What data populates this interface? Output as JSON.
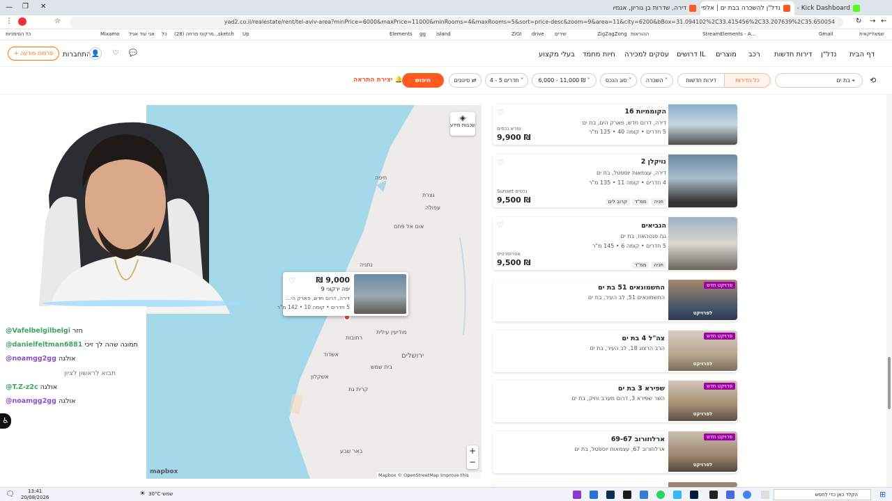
{
  "browser": {
    "tabs": [
      {
        "label": "Stream - Kick Dashboard",
        "active": false
      },
      {
        "label": "נדל\"ן להשכרה בבת ים | אלפי נכ...",
        "active": true
      },
      {
        "label": "דירה, שדרות בן גוריון, אגמים, בת...",
        "active": false
      }
    ],
    "url": "yad2.co.il/realestate/rent/tel-aviv-area?minPrice=6000&maxPrice=11000&minRooms=4&maxRooms=5&sort=price-desc&zoom=9&area=11&city=6200&bBox=31.094102%2C33.415456%2C33.207639%2C35.650054"
  },
  "bookmarks": [
    "כל הסימניות",
    "Mixamo",
    "אני עוד אגיל",
    "כל",
    "(28) מרקוס מרחה...",
    "sketch",
    "Up",
    "Elements",
    "gg",
    "island",
    "ZiGI",
    "drive",
    "שירים",
    "ZigZagZong",
    "ההוראות",
    "StreamElements - A...",
    "Gmail",
    "שמאליקאית"
  ],
  "header": {
    "nav": [
      "דף הבית",
      "נדל\"ן",
      "דירות חדשות",
      "רכב",
      "מוצרים",
      "דרושים IL",
      "עסקים למכירה",
      "חיות מחמד",
      "בעלי מקצוע"
    ],
    "login": "התחברות",
    "post_ad": "פרסום מודעה"
  },
  "search": {
    "location": "בת ים",
    "all_apartments": "כל הדירות",
    "new_apartments": "דירות חדשות",
    "deal": "השכרה",
    "property_type": "סוג הנכס",
    "price": "6,000 - 11,000 ₪",
    "rooms": "4 - 5 חדרים",
    "filters": "סינונים",
    "search_button": "חיפוש",
    "create_alert": "יצירת התראה"
  },
  "map": {
    "labels": [
      "חיפה",
      "נצרת",
      "עפולה",
      "אום אל פחם",
      "נתניה",
      "רחובות",
      "אשדוד",
      "מודיעין עילית",
      "בית שמש",
      "אשקלון",
      "קרית גת",
      "באר שבע"
    ],
    "capital": "ירושלים",
    "layers": "שכבות מידע",
    "attribution": "Mapbox © OpenStreetMap  Improve this map",
    "logo": "mapbox",
    "popup": {
      "price": "9,000 ₪",
      "street": "יפה ירקוני 9",
      "desc": "דירה, דרום חדש, פארק הי...",
      "details": "5 חדרים • קומה 10 • 142 מ\"ר"
    }
  },
  "listings": [
    {
      "title": "הקוממיות 16",
      "sub": "דירה, דרום חדש, פארק הים, בת ים",
      "details": "5 חדרים • קומה 40 • 125 מ\"ר",
      "agency": "עזרא נכסים",
      "price": "9,900 ₪",
      "tags": [],
      "new": false
    },
    {
      "title": "נויקלן 2",
      "sub": "דירה, עצמאות יוספטל, בת ים",
      "details": "4 חדרים • קומה 11 • 135 מ\"ר",
      "agency": "Sunset נכסים",
      "price": "9,500 ₪",
      "tags": [
        "חניה",
        "ממ\"ד",
        "קרוב לים"
      ],
      "new": false
    },
    {
      "title": "הנביאים",
      "sub": "גג/ פנטהאוז, בת ים",
      "details": "5 חדרים • קומה 6 • 145 מ\"ר",
      "agency": "אפרופרטיס",
      "price": "9,500 ₪",
      "tags": [
        "חניה",
        "ממ\"ד"
      ],
      "new": false
    },
    {
      "title": "החשמונאים 51 בת ים",
      "sub": "החשמונאים 51, לב העיר, בת ים",
      "new": true
    },
    {
      "title": "צה\"ל 4 בת ים",
      "sub": "הרב הרצוג 18, לב העיר, בת ים",
      "new": true
    },
    {
      "title": "שפירא 3 בת ים",
      "sub": "השר שפירא 3, דרום מערב וחיק, בת ים",
      "new": true
    },
    {
      "title": "ארלוזורוב 69-67",
      "sub": "ארלוזורוב 67, עצמאות יוספטל, בת ים",
      "new": true
    }
  ],
  "listing_badges": {
    "new_project": "פרויקט חדש",
    "to_project": "לפרויקט"
  },
  "chat": [
    {
      "user": "@Vafelbelgilbelgi",
      "msg": "חזר",
      "color": "#3da55d"
    },
    {
      "user": "@danielfeltman6881",
      "msg": "תמונה שהה לך זיכי",
      "color": "#3da55d"
    },
    {
      "user": "@noamgg2gg",
      "msg": "אולגה",
      "color": "#8a4fc8"
    },
    {
      "user": "",
      "msg": "תבוא לראשון לציון",
      "color": "#888"
    },
    {
      "user": "@T.Z-z2c",
      "msg": "אולגה",
      "color": "#3da55d"
    },
    {
      "user": "@noamgg2gg",
      "msg": "אולגה",
      "color": "#8a4fc8"
    }
  ],
  "taskbar": {
    "time": "13:41",
    "date": "20/08/2026",
    "temp": "30°C",
    "weather": "שמשי",
    "search": "הקלד כאן כדי לחפש"
  },
  "colors": {
    "accent": "#ff5a1f",
    "new_project": "#a100a6"
  }
}
